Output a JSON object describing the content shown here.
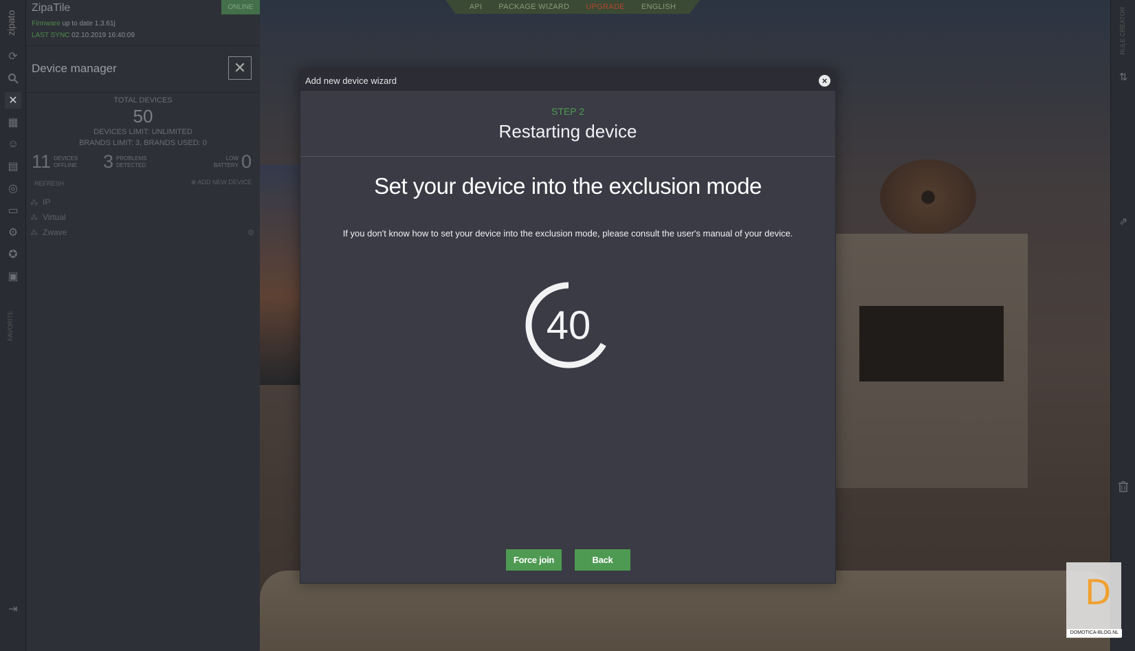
{
  "app": {
    "name": "ZipaTile",
    "status": "ONLINE",
    "firmware_label": "Firmware",
    "firmware_value": "up to date 1.3.61j",
    "sync_label": "LAST SYNC",
    "sync_value": "02.10.2019 16:40:09",
    "brand_vertical": "zipato"
  },
  "topnav": {
    "items": [
      "API",
      "PACKAGE WIZARD",
      "UPGRADE",
      "ENGLISH"
    ]
  },
  "panel": {
    "title": "Device manager",
    "total_label": "TOTAL DEVICES",
    "total_value": "50",
    "limit_text": "DEVICES LIMIT: UNLIMITED",
    "brands_text": "BRANDS LIMIT: 3, BRANDS USED: 0",
    "offline": {
      "value": "11",
      "line1": "DEVICES",
      "line2": "OFFLINE"
    },
    "problems": {
      "value": "3",
      "line1": "PROBLEMS",
      "line2": "DETECTED"
    },
    "battery": {
      "value": "0",
      "line1": "LOW",
      "line2": "BATTERY"
    },
    "refresh_label": "REFRESH",
    "add_label": "ADD NEW DEVICE",
    "tree": [
      "IP",
      "Virtual",
      "Zwave"
    ],
    "favorite_label": "FAVORITE"
  },
  "right_rail": {
    "vertical_label": "RULE CREATOR"
  },
  "modal": {
    "title": "Add new device wizard",
    "step": "STEP 2",
    "subtitle": "Restarting device",
    "heading": "Set your device into the exclusion mode",
    "instructions": "If you don't know how to set your device into the exclusion mode, please consult the user's manual of your device.",
    "countdown": "40",
    "countdown_progress": 0.67,
    "force_join_label": "Force join",
    "back_label": "Back"
  },
  "watermark": {
    "letter": "D",
    "text": "DOMOTICA-BLOG.NL"
  },
  "colors": {
    "accent_green": "#4e9a53",
    "upgrade_red": "#b0462e",
    "modal_bg": "#3a3b45"
  }
}
